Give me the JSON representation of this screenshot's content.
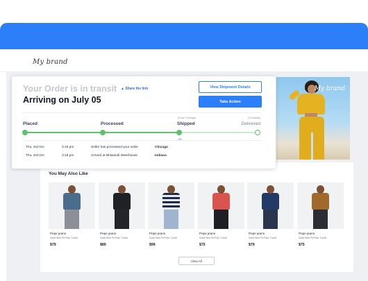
{
  "brand": {
    "logo_text": "My brand"
  },
  "hero": {
    "overlay_text": "My brand"
  },
  "order": {
    "status_text": "Your Order is in transit",
    "share_link": "▲ Share the link",
    "arriving_text": "Arriving on July 05",
    "view_shipment_label": "View Shipment Details",
    "take_action_label": "Take Action"
  },
  "tracking": {
    "stages": [
      {
        "label": "Placed",
        "sublabel": "",
        "done": true
      },
      {
        "label": "Processed",
        "sublabel": "",
        "done": true
      },
      {
        "label": "Shipped",
        "sublabel": "(From Chicago)",
        "done": true
      },
      {
        "label": "Delivered",
        "sublabel": "(To Dallas)",
        "done": false
      }
    ],
    "progress_fraction": 0.67,
    "events": [
      {
        "date": "Thu, 3rd Oct",
        "time": "3:15 pm",
        "message": "Seller has processed your order",
        "location": "Chicago"
      },
      {
        "date": "Thu, 3rd Oct",
        "time": "3:18 pm",
        "message": "Arrived at Bhiwandi Warehouse",
        "location": "Indiana"
      }
    ]
  },
  "recommendations": {
    "title": "You May Also Like",
    "view_all_label": "View All",
    "products": [
      {
        "brand": "Pepe jeans",
        "desc": "Solid Slim Fit Polo T-shirt",
        "price": "$79"
      },
      {
        "brand": "Pepe jeans",
        "desc": "Solid Slim Fit Polo T-shirt",
        "price": "$89"
      },
      {
        "brand": "Pepe jeans",
        "desc": "Solid Slim Fit Polo T-shirt",
        "price": "$99"
      },
      {
        "brand": "Pepe jeans",
        "desc": "Solid Slim Fit Polo T-shirt",
        "price": "$75"
      },
      {
        "brand": "Pepe jeans",
        "desc": "Solid Slim Fit Polo T-shirt",
        "price": "$79"
      },
      {
        "brand": "Pepe jeans",
        "desc": "Solid Slim Fit Polo T-shirt",
        "price": "$75"
      }
    ]
  },
  "colors": {
    "accent": "#2d7ff9",
    "progress": "#5cc26b",
    "progress_pending": "#c9ecd0"
  }
}
